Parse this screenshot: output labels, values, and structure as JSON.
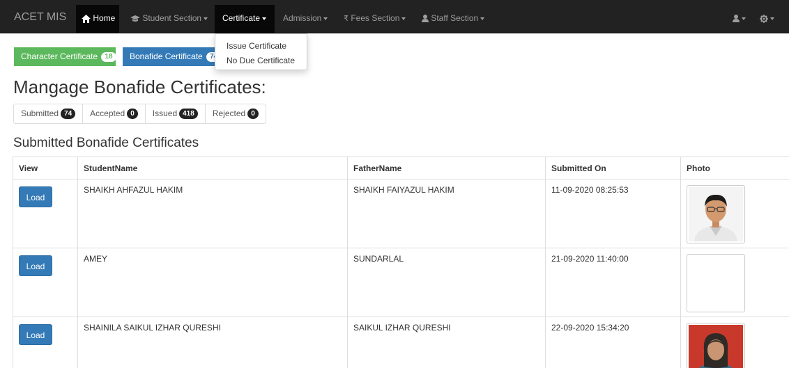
{
  "navbar": {
    "brand": "ACET MIS",
    "items": [
      {
        "label": "Home",
        "icon": "home-icon"
      },
      {
        "label": "Student Section",
        "icon": "graduation-cap-icon"
      },
      {
        "label": "Certificate"
      },
      {
        "label": "Admission"
      },
      {
        "label": "Fees Section",
        "icon": "rupee-icon"
      },
      {
        "label": "Staff Section",
        "icon": "user-icon"
      }
    ],
    "right_icons": [
      "user-icon",
      "cog-icon"
    ]
  },
  "certificate_menu": {
    "items": [
      "Issue Certificate",
      "No Due Certificate"
    ]
  },
  "pills": [
    {
      "label": "Character Certificate",
      "count": "18",
      "color": "#5cb85c"
    },
    {
      "label": "Bonafide Certificate",
      "count": "74",
      "color": "#337ab7"
    }
  ],
  "heading": "Mangage Bonafide Certificates:",
  "status_tabs": [
    {
      "label": "Submitted",
      "count": "74"
    },
    {
      "label": "Accepted",
      "count": "0"
    },
    {
      "label": "Issued",
      "count": "418"
    },
    {
      "label": "Rejected",
      "count": "0"
    }
  ],
  "subheading": "Submitted Bonafide Certificates",
  "table": {
    "columns": [
      "View",
      "StudentName",
      "FatherName",
      "Submitted On",
      "Photo"
    ],
    "load_label": "Load",
    "rows": [
      {
        "student": "SHAIKH AHFAZUL HAKIM",
        "father": "SHAIKH FAIYAZUL HAKIM",
        "submitted_on": "11-09-2020 08:25:53",
        "photo": "male-portrait"
      },
      {
        "student": "AMEY",
        "father": "SUNDARLAL",
        "submitted_on": "21-09-2020 11:40:00",
        "photo": "empty"
      },
      {
        "student": "SHAINILA SAIKUL IZHAR QURESHI",
        "father": "SAIKUL IZHAR QURESHI",
        "submitted_on": "22-09-2020 15:34:20",
        "photo": "female-portrait"
      }
    ]
  },
  "colors": {
    "navbar": "#222222",
    "primary": "#337ab7",
    "success": "#5cb85c"
  }
}
